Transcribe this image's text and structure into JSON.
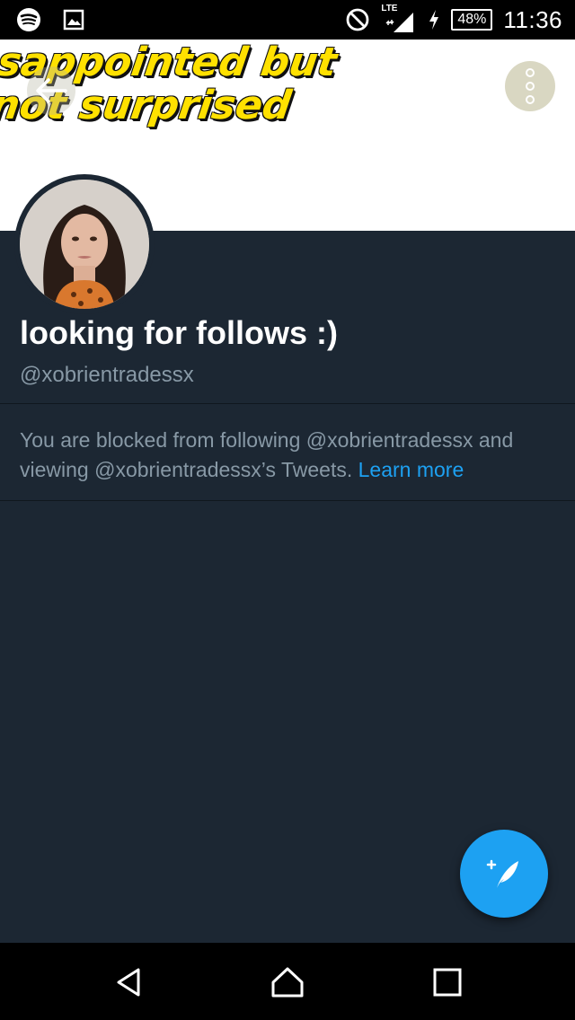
{
  "status_bar": {
    "time": "11:36",
    "battery": "48%",
    "network": "LTE",
    "icons": [
      "spotify-icon",
      "image-notification-icon",
      "do-not-disturb-icon",
      "signal-icon",
      "charging-icon",
      "battery-icon"
    ]
  },
  "header": {
    "banner_text": "sappointed but\nnot surprised",
    "banner_color": "#ffe100"
  },
  "profile": {
    "display_name": "looking for follows :)",
    "handle": "@xobrientradessx"
  },
  "blocked_notice": {
    "text": "You are blocked from following @xobrientradessx and viewing @xobrientradessx’s Tweets.",
    "link": "Learn more"
  },
  "colors": {
    "background": "#1c2733",
    "accent": "#1da1f2",
    "secondary_text": "#8899a6"
  }
}
